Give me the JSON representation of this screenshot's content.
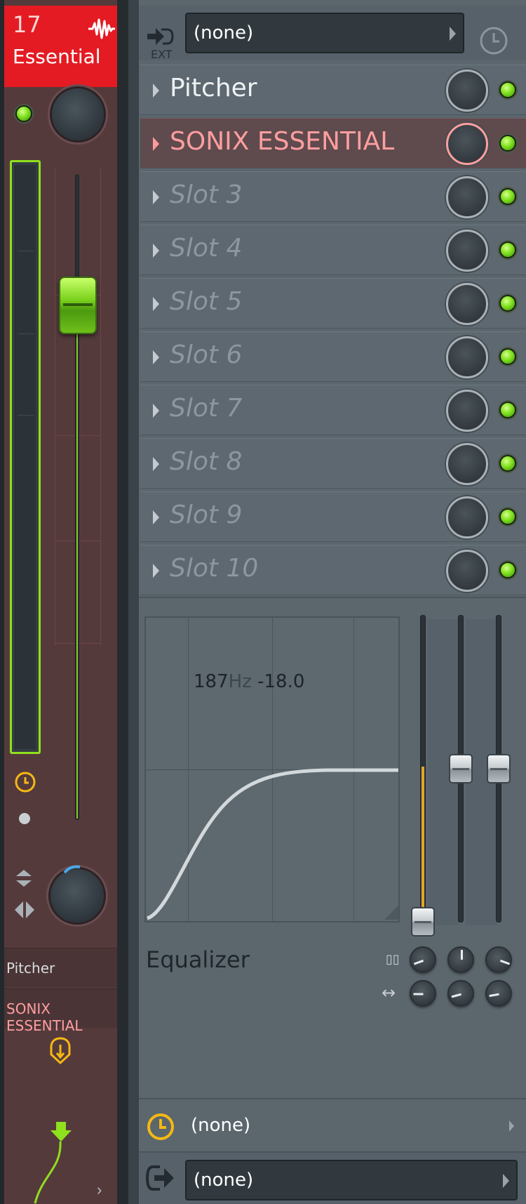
{
  "mixer_strip": {
    "number": "17",
    "name": "Essential",
    "header_color": "#e41b23",
    "slot_labels": [
      "Pitcher",
      "SONIX ESSENTIAL"
    ],
    "icons": [
      "waveform-icon",
      "clock-icon",
      "up-down-arrows-icon",
      "stereo-separation-icon",
      "route-icon",
      "down-arrow-icon"
    ]
  },
  "effects_panel": {
    "input_dropdown": {
      "ext_label": "EXT",
      "value": "(none)"
    },
    "slots": [
      {
        "name": "Pitcher",
        "state": "filled"
      },
      {
        "name": "SONIX ESSENTIAL",
        "state": "active"
      },
      {
        "name": "Slot 3",
        "state": "empty"
      },
      {
        "name": "Slot 4",
        "state": "empty"
      },
      {
        "name": "Slot 5",
        "state": "empty"
      },
      {
        "name": "Slot 6",
        "state": "empty"
      },
      {
        "name": "Slot 7",
        "state": "empty"
      },
      {
        "name": "Slot 8",
        "state": "empty"
      },
      {
        "name": "Slot 9",
        "state": "empty"
      },
      {
        "name": "Slot 10",
        "state": "empty"
      }
    ],
    "equalizer": {
      "label": "Equalizer",
      "readout_freq": "187",
      "readout_unit": "Hz",
      "readout_gain": "-18.0"
    },
    "time_dropdown": {
      "value": "(none)"
    },
    "output_dropdown": {
      "value": "(none)"
    }
  }
}
